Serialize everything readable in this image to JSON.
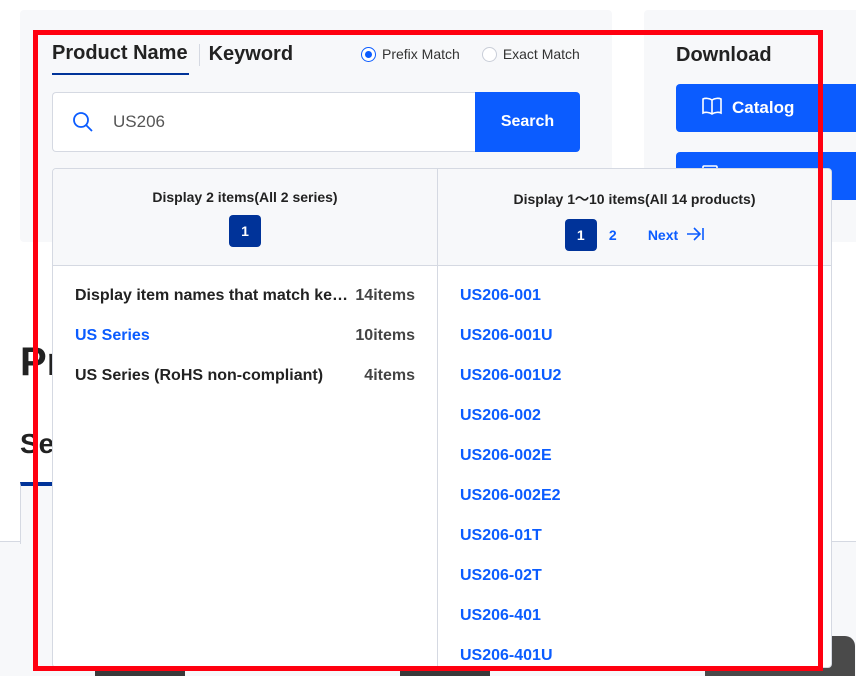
{
  "search": {
    "tabs": [
      {
        "label": "Product Name",
        "active": true
      },
      {
        "label": "Keyword",
        "active": false
      }
    ],
    "match_options": [
      {
        "label": "Prefix Match",
        "checked": true
      },
      {
        "label": "Exact Match",
        "checked": false
      }
    ],
    "query": "US206",
    "search_icon": "search-icon",
    "button_label": "Search"
  },
  "download": {
    "title": "Download",
    "buttons": [
      {
        "label": "Catalog",
        "icon": "book-icon"
      },
      {
        "label": "",
        "icon": "document-icon"
      }
    ]
  },
  "background": {
    "heading_fragment": "Pr",
    "subheading_fragment": "Se"
  },
  "results": {
    "series_column": {
      "summary": "Display 2 items(All 2 series)",
      "pages": [
        "1"
      ],
      "current_page": "1",
      "items": [
        {
          "name": "Display item names that match key…",
          "count": "14items",
          "link": false
        },
        {
          "name": "US Series",
          "count": "10items",
          "link": true
        },
        {
          "name": "US Series (RoHS non-compliant)",
          "count": "4items",
          "link": false
        }
      ]
    },
    "products_column": {
      "summary": "Display 1～10 items(All 14 products)",
      "pages": [
        "1",
        "2"
      ],
      "current_page": "1",
      "next_label": "Next",
      "next_icon": "arrow-right-to-bar-icon",
      "items": [
        "US206-001",
        "US206-001U",
        "US206-001U2",
        "US206-002",
        "US206-002E",
        "US206-002E2",
        "US206-01T",
        "US206-02T",
        "US206-401",
        "US206-401U"
      ]
    }
  },
  "colors": {
    "accent": "#0b5cff",
    "navy": "#003399",
    "highlight": "#ff0010",
    "panel_bg": "#f7f8fa",
    "border": "#d5d9e2"
  }
}
